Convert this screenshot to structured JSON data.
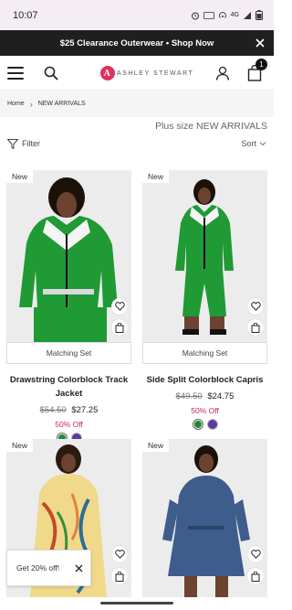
{
  "status_bar": {
    "time": "10:07",
    "network": "4G"
  },
  "promo": {
    "text": "$25 Clearance Outerwear • Shop Now"
  },
  "header": {
    "logo_text": "ASHLEY STEWART",
    "bag_count": "1"
  },
  "breadcrumb": {
    "home": "Home",
    "current": "NEW ARRIVALS"
  },
  "plp": {
    "title": "Plus size NEW ARRIVALS",
    "filter_label": "Filter",
    "sort_label": "Sort"
  },
  "products": [
    {
      "badge": "New",
      "set_label": "Matching Set",
      "name": "Drawstring Colorblock Track Jacket",
      "old_price": "$54.50",
      "price": "$27.25",
      "discount": "50% Off",
      "swatches": [
        "#1e8a35",
        "#5b3aa0"
      ]
    },
    {
      "badge": "New",
      "set_label": "Matching Set",
      "name": "Side Split Colorblock Capris",
      "old_price": "$49.50",
      "price": "$24.75",
      "discount": "50% Off",
      "swatches": [
        "#1e8a35",
        "#5b3aa0"
      ]
    },
    {
      "badge": "New"
    },
    {
      "badge": "New"
    }
  ],
  "offer": {
    "text": "Get 20% off!"
  },
  "colors": {
    "accent": "#d0245a",
    "promo_bg": "#1f1f1f",
    "brand": "#e0315f"
  }
}
